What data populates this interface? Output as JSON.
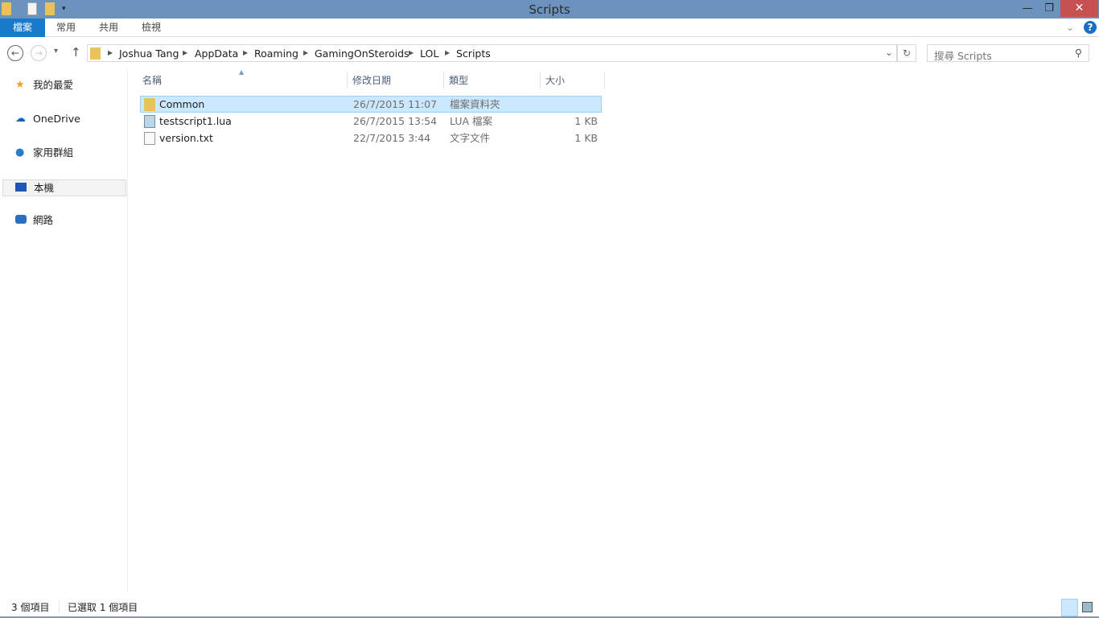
{
  "window": {
    "title": "Scripts",
    "minimize": "—",
    "restore": "❐",
    "close": "✕"
  },
  "ribbon": {
    "tabs": [
      "檔案",
      "常用",
      "共用",
      "檢視"
    ],
    "help": "?",
    "expand": "⌄"
  },
  "nav": {
    "back": "←",
    "forward": "→",
    "recent": "▾",
    "up": "↑",
    "breadcrumbs": [
      "Joshua Tang",
      "AppData",
      "Roaming",
      "GamingOnSteroids",
      "LOL",
      "Scripts"
    ],
    "dropdown": "⌄",
    "refresh": "↻",
    "search_placeholder": "搜尋 Scripts",
    "search_icon": "⚲"
  },
  "sidebar": {
    "items": [
      {
        "label": "我的最愛",
        "icon": "star-icon"
      },
      {
        "label": "OneDrive",
        "icon": "cloud-icon"
      },
      {
        "label": "家用群組",
        "icon": "homegroup-icon"
      },
      {
        "label": "本機",
        "icon": "computer-icon"
      },
      {
        "label": "網路",
        "icon": "network-icon"
      }
    ]
  },
  "columns": {
    "name": "名稱",
    "date": "修改日期",
    "type": "類型",
    "size": "大小"
  },
  "files": [
    {
      "name": "Common",
      "date": "26/7/2015 11:07",
      "type": "檔案資料夾",
      "size": "",
      "icon": "folder-icon",
      "selected": true
    },
    {
      "name": "testscript1.lua",
      "date": "26/7/2015 13:54",
      "type": "LUA 檔案",
      "size": "1 KB",
      "icon": "lua-file-icon",
      "selected": false
    },
    {
      "name": "version.txt",
      "date": "22/7/2015 3:44",
      "type": "文字文件",
      "size": "1 KB",
      "icon": "text-file-icon",
      "selected": false
    }
  ],
  "status": {
    "count": "3 個項目",
    "selected": "已選取 1 個項目"
  },
  "colors": {
    "titlebar": "#6b93bd",
    "file_tab": "#1979ca",
    "selection": "#cce8ff",
    "close": "#c75050"
  }
}
